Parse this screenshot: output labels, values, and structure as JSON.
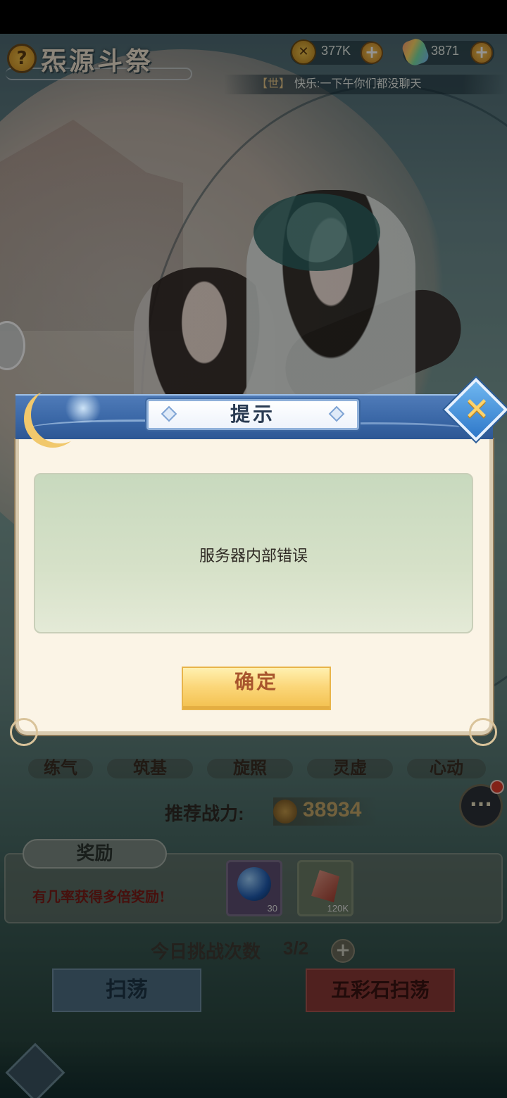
{
  "header": {
    "title": "炁源斗祭",
    "help_label": "?",
    "gold_amount": "377K",
    "gem_amount": "3871",
    "plus_label": "+"
  },
  "chat_ticker": {
    "channel": "【世】",
    "message": "快乐:一下午你们都没聊天"
  },
  "realms": [
    "练气",
    "筑基",
    "旋照",
    "灵虚",
    "心动"
  ],
  "power": {
    "label": "推荐战力:",
    "value": "38934"
  },
  "reward": {
    "tab_label": "奖励",
    "note": "有几率获得多倍奖励!",
    "items": [
      {
        "icon": "blue-orb-icon",
        "count": "30"
      },
      {
        "icon": "red-crystal-icon",
        "count": "120K"
      }
    ]
  },
  "challenge": {
    "label": "今日挑战次数",
    "value": "3/2",
    "plus_label": "+"
  },
  "buttons": {
    "sweep": "扫荡",
    "stone_sweep": "五彩石扫荡"
  },
  "chat_button_label": "···",
  "dialog": {
    "title": "提示",
    "message": "服务器内部错误",
    "confirm_label": "确定",
    "close_label": "✕"
  },
  "colors": {
    "dialog_header": "#3c69a8",
    "dialog_body": "#fbf4e6",
    "confirm_button": "#f3c04e",
    "message_box": "#d6e1c8"
  }
}
